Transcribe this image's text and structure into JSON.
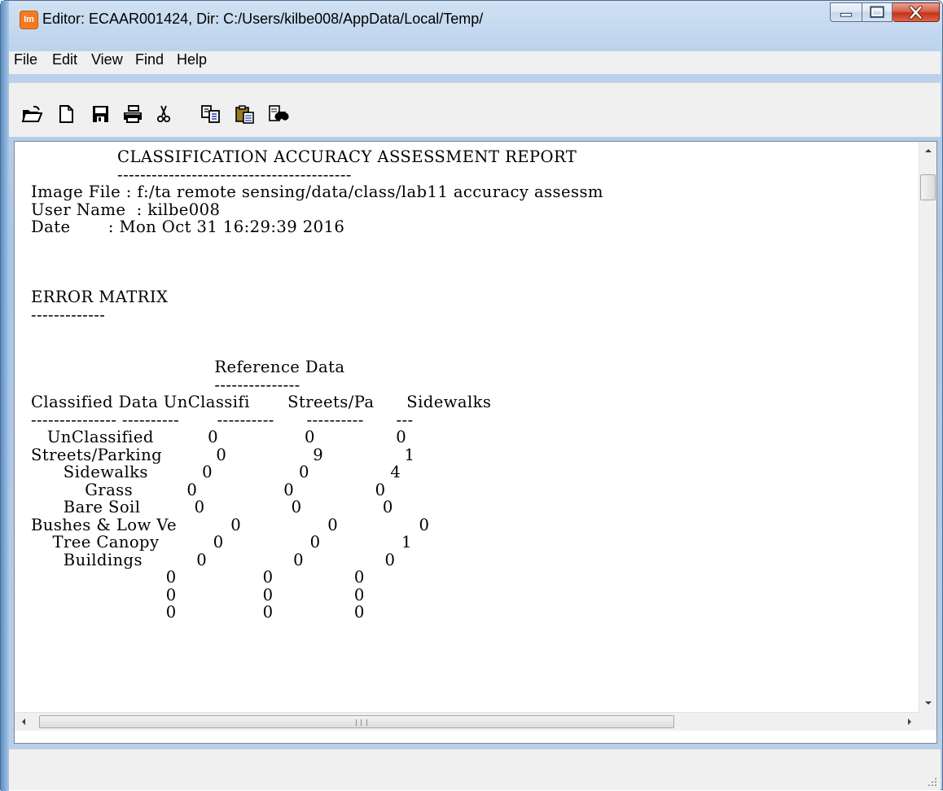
{
  "window": {
    "title": "Editor: ECAAR001424, Dir: C:/Users/kilbe008/AppData/Local/Temp/",
    "app_icon_label": "Im"
  },
  "menu": [
    {
      "label": "File"
    },
    {
      "label": "Edit"
    },
    {
      "label": "View"
    },
    {
      "label": "Find"
    },
    {
      "label": "Help"
    }
  ],
  "toolbar": [
    {
      "name": "open-icon"
    },
    {
      "name": "new-document-icon"
    },
    {
      "name": "save-icon"
    },
    {
      "name": "print-icon"
    },
    {
      "name": "cut-icon"
    },
    {
      "name": "copy-icon"
    },
    {
      "name": "paste-icon"
    },
    {
      "name": "find-icon"
    }
  ],
  "report": {
    "lines": [
      "                CLASSIFICATION ACCURACY ASSESSMENT REPORT",
      "                -----------------------------------------",
      "Image File : f:/ta remote sensing/data/class/lab11 accuracy assessm",
      "User Name  : kilbe008",
      "Date       : Mon Oct 31 16:29:39 2016",
      "",
      "",
      "",
      "ERROR MATRIX",
      "-------------",
      "",
      "",
      "                                  Reference Data",
      "                                  ---------------",
      "Classified Data UnClassifi       Streets/Pa      Sidewalks",
      "--------------- ----------       ----------      ----------      ---",
      "   UnClassified          0                0               0",
      "Streets/Parking          0                9               1",
      "      Sidewalks          0                0               4",
      "          Grass          0                0               0",
      "      Bare Soil          0                0               0",
      "Bushes & Low Ve          0                0               0",
      "    Tree Canopy          0                0               1",
      "      Buildings          0                0               0",
      "                         0                0               0",
      "                         0                0               0",
      "                         0                0               0"
    ]
  },
  "scrollbar": {
    "horizontal_grip": "III"
  },
  "status": {
    "text": ""
  }
}
